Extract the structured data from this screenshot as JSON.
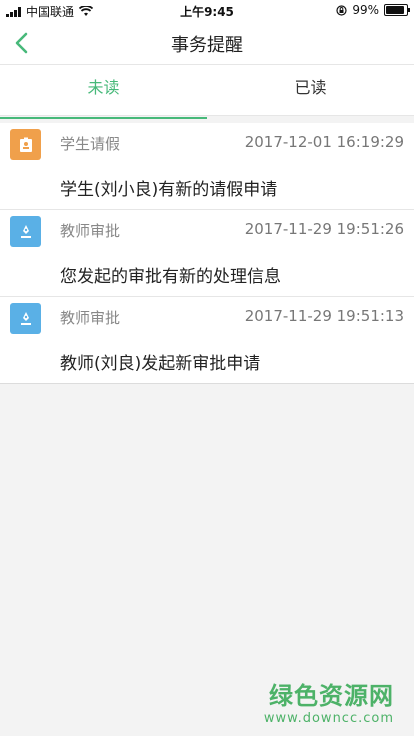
{
  "status_bar": {
    "carrier": "中国联通",
    "time": "上午9:45",
    "battery": "99%",
    "battery_level": 0.99
  },
  "nav": {
    "title": "事务提醒",
    "back_icon": "chevron-left-icon",
    "accent_color": "#47b97a"
  },
  "tabs": [
    {
      "label": "未读",
      "active": true
    },
    {
      "label": "已读",
      "active": false
    }
  ],
  "notifications": [
    {
      "category": "学生请假",
      "time": "2017-12-01 16:19:29",
      "message": "学生(刘小良)有新的请假申请",
      "icon": "student-leave-icon",
      "icon_color": "#f0a04b"
    },
    {
      "category": "教师审批",
      "time": "2017-11-29 19:51:26",
      "message": "您发起的审批有新的处理信息",
      "icon": "teacher-approval-icon",
      "icon_color": "#5ab0e6"
    },
    {
      "category": "教师审批",
      "time": "2017-11-29 19:51:13",
      "message": "教师(刘良)发起新审批申请",
      "icon": "teacher-approval-icon",
      "icon_color": "#5ab0e6"
    }
  ],
  "watermark": {
    "line1": "绿色资源网",
    "line2": "www.downcc.com"
  }
}
